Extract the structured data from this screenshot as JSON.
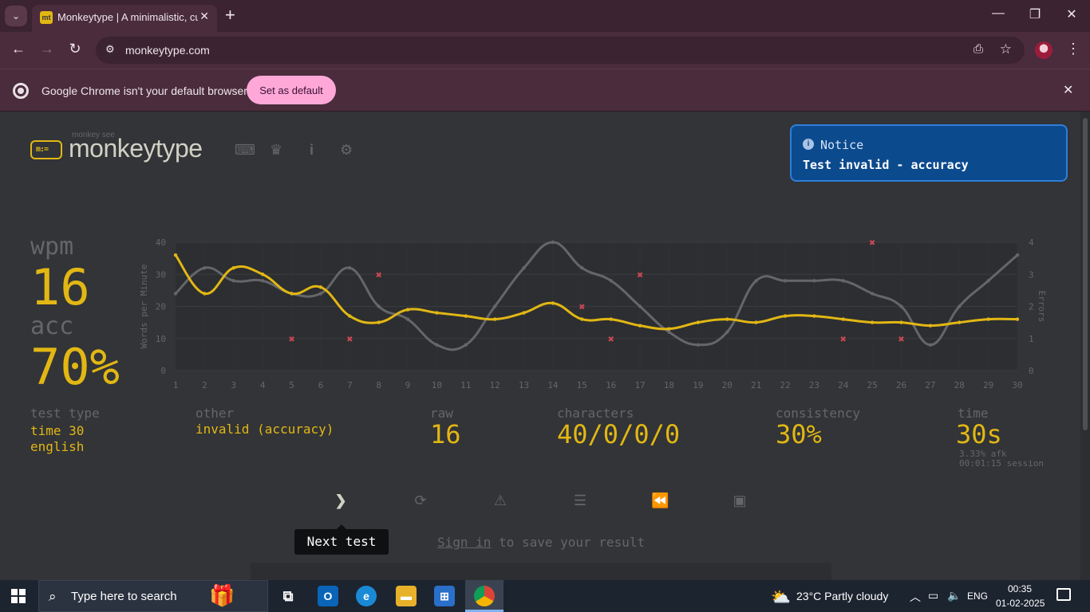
{
  "browser": {
    "tab_title": "Monkeytype | A minimalistic, customizable typing test",
    "favicon_text": "mt",
    "url": "monkeytype.com",
    "infobar_text": "Google Chrome isn't your default browser",
    "set_default_label": "Set as default"
  },
  "header": {
    "logo_small": "monkey see",
    "logo_text": "monkeytype",
    "logo_icon_text": "m:="
  },
  "notice": {
    "title": "Notice",
    "message": "Test invalid - accuracy"
  },
  "results": {
    "wpm_label": "wpm",
    "wpm_value": "16",
    "acc_label": "acc",
    "acc_value": "70%",
    "test_type_label": "test type",
    "test_type_line1": "time 30",
    "test_type_line2": "english",
    "other_label": "other",
    "other_value": "invalid (accuracy)",
    "raw_label": "raw",
    "raw_value": "16",
    "characters_label": "characters",
    "characters_value": "40/0/0/0",
    "consistency_label": "consistency",
    "consistency_value": "30%",
    "time_label": "time",
    "time_value": "30s",
    "afk": "3.33% afk",
    "session": "00:01:15 session"
  },
  "actions": {
    "tooltip": "Next test",
    "signin_link": "Sign in",
    "signin_rest": " to save your result"
  },
  "chart_data": {
    "type": "line",
    "ylabel": "Words per Minute",
    "y2label": "Errors",
    "ylim": [
      0,
      40
    ],
    "y2lim": [
      0,
      4
    ],
    "yticks": [
      0,
      10,
      20,
      30,
      40
    ],
    "y2ticks": [
      0,
      1,
      2,
      3,
      4
    ],
    "x": [
      1,
      2,
      3,
      4,
      5,
      6,
      7,
      8,
      9,
      10,
      11,
      12,
      13,
      14,
      15,
      16,
      17,
      18,
      19,
      20,
      21,
      22,
      23,
      24,
      25,
      26,
      27,
      28,
      29,
      30
    ],
    "series": [
      {
        "role": "raw",
        "color": "#646669",
        "values": [
          24,
          32,
          28,
          28,
          24,
          24,
          32,
          20,
          16,
          8,
          8,
          20,
          32,
          40,
          32,
          28,
          20,
          12,
          8,
          12,
          28,
          28,
          28,
          28,
          24,
          20,
          8,
          20,
          28,
          36
        ]
      },
      {
        "role": "wpm",
        "color": "#e2b714",
        "values": [
          36,
          24,
          32,
          30,
          24,
          26,
          17,
          15,
          19,
          18,
          17,
          16,
          18,
          21,
          16,
          16,
          14,
          13,
          15,
          16,
          15,
          17,
          17,
          16,
          15,
          15,
          14,
          15,
          16,
          16
        ]
      }
    ],
    "errors": [
      {
        "x": 5,
        "value": 1
      },
      {
        "x": 7,
        "value": 1
      },
      {
        "x": 8,
        "value": 3
      },
      {
        "x": 15,
        "value": 2
      },
      {
        "x": 16,
        "value": 1
      },
      {
        "x": 17,
        "value": 3
      },
      {
        "x": 24,
        "value": 1
      },
      {
        "x": 25,
        "value": 4
      },
      {
        "x": 26,
        "value": 1
      }
    ],
    "error_color": "#ca4754",
    "grid": true
  },
  "taskbar": {
    "search_placeholder": "Type here to search",
    "weather": "23°C  Partly cloudy",
    "lang": "ENG",
    "time": "00:35",
    "date": "01-02-2025"
  }
}
